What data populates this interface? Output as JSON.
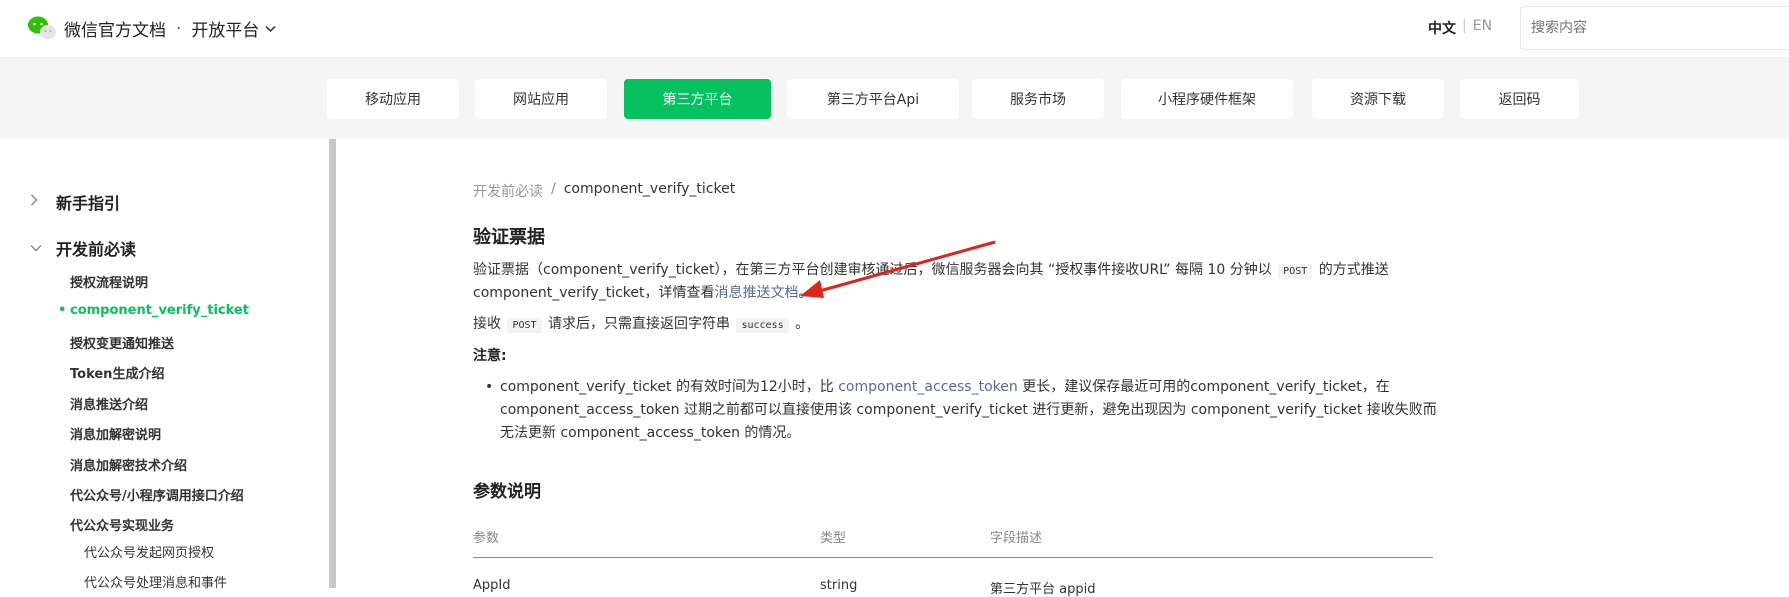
{
  "header": {
    "brand_title": "微信官方文档",
    "brand_dot": "·",
    "brand_product": "开放平台",
    "lang_zh": "中文",
    "lang_sep": "|",
    "lang_en": "EN",
    "search_placeholder": "搜索内容",
    "icons": {
      "logo": "wechat-logo",
      "dropdown": "chevron-down-icon"
    }
  },
  "nav": {
    "items": [
      {
        "label": "移动应用",
        "active": false
      },
      {
        "label": "网站应用",
        "active": false
      },
      {
        "label": "第三方平台",
        "active": true
      },
      {
        "label": "第三方平台Api",
        "active": false
      },
      {
        "label": "服务市场",
        "active": false
      },
      {
        "label": "小程序硬件框架",
        "active": false
      },
      {
        "label": "资源下载",
        "active": false
      },
      {
        "label": "返回码",
        "active": false
      }
    ],
    "accent": "#07c160"
  },
  "sidebar": {
    "sections": [
      {
        "label": "新手指引",
        "expanded": false
      },
      {
        "label": "开发前必读",
        "expanded": true
      }
    ],
    "items": [
      "授权流程说明",
      "component_verify_ticket",
      "授权变更通知推送",
      "Token生成介绍",
      "消息推送介绍",
      "消息加解密说明",
      "消息加解密技术介绍",
      "代公众号/小程序调用接口介绍",
      "代公众号实现业务"
    ],
    "subitems": [
      "代公众号发起网页授权",
      "代公众号处理消息和事件"
    ],
    "active_item": "component_verify_ticket"
  },
  "content": {
    "breadcrumb": {
      "parent": "开发前必读",
      "sep": "/",
      "current": "component_verify_ticket"
    },
    "title": "验证票据",
    "p1_a": "验证票据（component_verify_ticket），在第三方平台创建审核通过后，微信服务器会向其 “授权事件接收URL” 每隔 10 分钟以",
    "p1_code": "POST",
    "p1_b": "的方式推送",
    "p1_c": "component_verify_ticket，详情查看",
    "p1_link": "消息推送文档",
    "p1_d": "。",
    "p2_a": "接收",
    "p2_code1": "POST",
    "p2_b": "请求后，只需直接返回字符串",
    "p2_code2": "success",
    "p2_c": "。",
    "note": "注意:",
    "bullet_bullet": "•",
    "bullet_a": "component_verify_ticket 的有效时间为12小时，比",
    "bullet_link": "component_access_token",
    "bullet_b": "更长，建议保存最近可用的component_verify_ticket，在 component_access_token 过期之前都可以直接使用该 component_verify_ticket 进行更新，避免出现因为 component_verify_ticket 接收失败而无法更新 component_access_token 的情况。",
    "params_title": "参数说明",
    "table": {
      "headers": [
        "参数",
        "类型",
        "字段描述"
      ],
      "rows": [
        [
          "AppId",
          "string",
          "第三方平台 appid"
        ]
      ]
    }
  }
}
